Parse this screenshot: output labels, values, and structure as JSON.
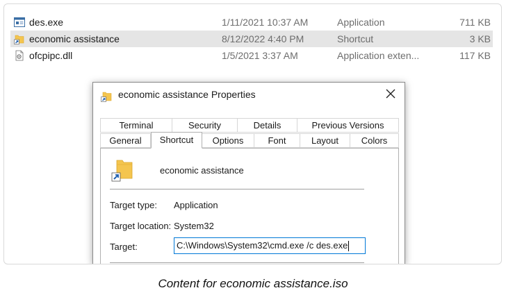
{
  "files": [
    {
      "name": "des.exe",
      "date": "1/11/2021 10:37 AM",
      "type": "Application",
      "size": "711 KB",
      "icon": "application-exe-icon",
      "selected": false
    },
    {
      "name": "economic assistance",
      "date": "8/12/2022 4:40 PM",
      "type": "Shortcut",
      "size": "3 KB",
      "icon": "folder-shortcut-icon",
      "selected": true
    },
    {
      "name": "ofcpipc.dll",
      "date": "1/5/2021 3:37 AM",
      "type": "Application exten...",
      "size": "117 KB",
      "icon": "dll-file-icon",
      "selected": false
    }
  ],
  "dialog": {
    "title": "economic assistance Properties",
    "tabs_top": [
      "Terminal",
      "Security",
      "Details",
      "Previous Versions"
    ],
    "tabs_bottom": [
      "General",
      "Shortcut",
      "Options",
      "Font",
      "Layout",
      "Colors"
    ],
    "active_tab": "Shortcut",
    "shortcut_name": "economic assistance",
    "target_type_label": "Target type:",
    "target_type_value": "Application",
    "target_location_label": "Target location:",
    "target_location_value": "System32",
    "target_label": "Target:",
    "target_value": "C:\\Windows\\System32\\cmd.exe /c des.exe"
  },
  "caption": "Content for economic assistance.iso",
  "colors": {
    "selection": "#e5e5e5",
    "input_focus": "#0078d7",
    "folder": "#f4c54f"
  }
}
